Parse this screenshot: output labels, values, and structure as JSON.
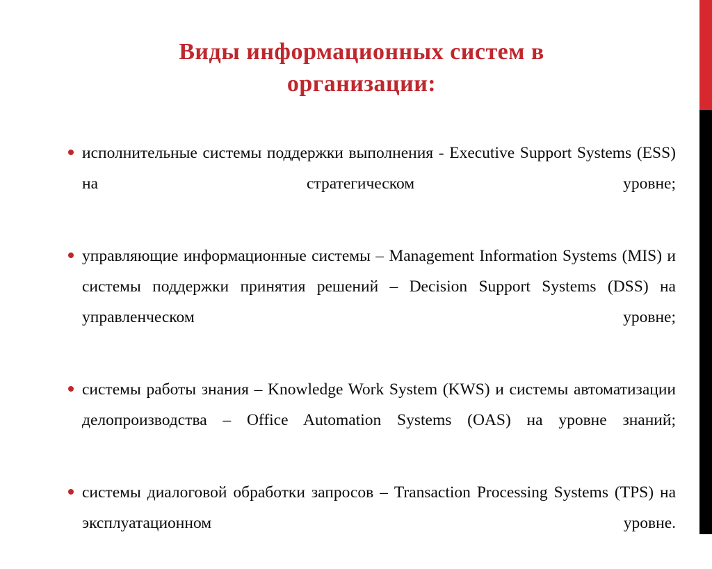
{
  "slide": {
    "background_color": "#ffffff",
    "accent_color": "#c0272d",
    "text_color": "#0d0d0d"
  },
  "title": {
    "line1": "Виды информационных систем в",
    "line2": "организации:",
    "color": "#c0272d"
  },
  "bullets": [
    {
      "marker": "round-bullet",
      "marker_color": "#c0272d",
      "text": "исполнительные системы поддержки выполнения - Executive Support Systems (ESS) на стратегическом уровне;"
    },
    {
      "marker": "round-bullet",
      "marker_color": "#c0272d",
      "text": "управляющие информационные системы – Management Information Systems (MIS) и системы поддержки принятия решений – Decision Support Systems (DSS) на управленческом уровне;"
    },
    {
      "marker": "round-bullet",
      "marker_color": "#c0272d",
      "text": "системы работы знания – Knowledge Work System (KWS) и системы автоматизации делопроизводства – Office Automation Systems (OAS) на уровне знаний;"
    },
    {
      "marker": "round-bullet",
      "marker_color": "#c0272d",
      "text": "системы диалоговой обработки запросов – Transaction Processing Systems (TPS) на эксплуатационном уровне."
    }
  ],
  "decoration": {
    "edge_bar_top_color": "#d8282f",
    "edge_bar_bottom_color": "#000000"
  }
}
